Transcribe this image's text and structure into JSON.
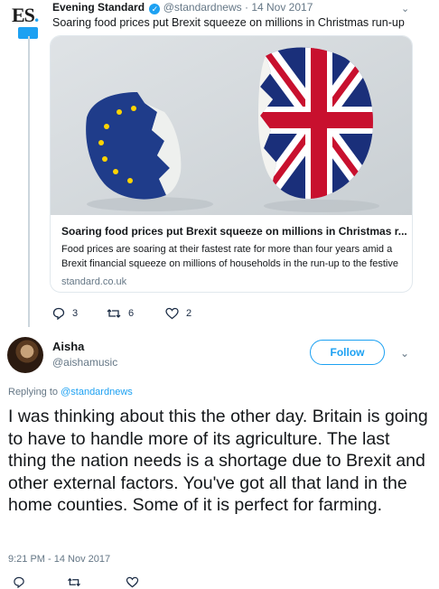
{
  "quoted_tweet": {
    "logo_text": "ES",
    "logo_dot": ".",
    "display_name": "Evening Standard",
    "handle": "@standardnews",
    "separator": "·",
    "date": "14 Nov 2017",
    "text": "Soaring food prices put Brexit squeeze on millions in Christmas run-up",
    "card": {
      "title": "Soaring food prices put Brexit squeeze on millions in Christmas r...",
      "description": "Food prices are soaring at their fastest rate for more than four years amid a Brexit financial squeeze on millions of households in the run-up to the festive",
      "domain": "standard.co.uk"
    },
    "actions": {
      "replies": "3",
      "retweets": "6",
      "likes": "2"
    }
  },
  "reply_tweet": {
    "display_name": "Aisha",
    "handle": "@aishamusic",
    "follow_label": "Follow",
    "replying_prefix": "Replying to",
    "replying_handle": "@standardnews",
    "text": "I was thinking about this the other day. Britain is going to have to handle more of its agriculture. The last thing the nation needs is a shortage due to Brexit and other external factors. You've got all that land in the home counties. Some of it is perfect for farming.",
    "timestamp": "9:21 PM - 14 Nov 2017"
  },
  "icons": {
    "verified": "verified-badge-icon",
    "reply": "reply-icon",
    "retweet": "retweet-icon",
    "like": "heart-icon",
    "caret": "chevron-down-icon"
  },
  "colors": {
    "accent": "#1da1f2",
    "muted": "#657786",
    "text": "#14171a",
    "border": "#e1e8ed"
  }
}
